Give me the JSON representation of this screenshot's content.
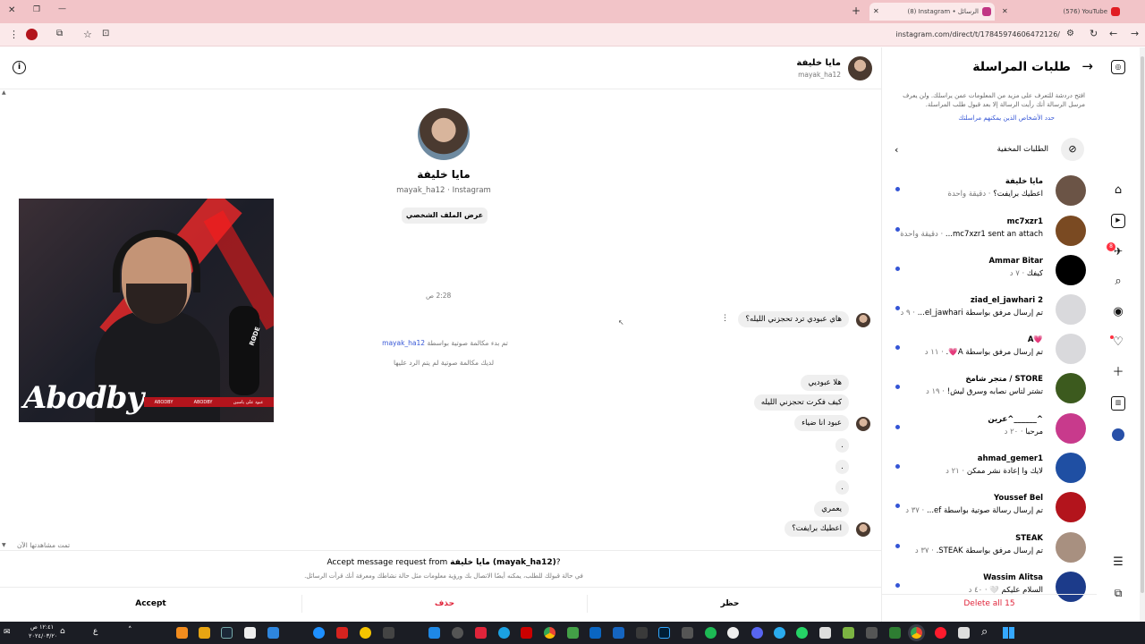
{
  "tabs": [
    {
      "label": "(576) YouTube",
      "favicon_color": "#e11d23"
    },
    {
      "label": "(8) Instagram • الرسائل",
      "favicon_color": "#c13584"
    }
  ],
  "window": {
    "min": "—",
    "restore": "❐",
    "close": "✕",
    "new_tab": "+"
  },
  "address_bar": {
    "url": "instagram.com/direct/t/17845974606472126/"
  },
  "chat_header": {
    "name": "مايا خليفة",
    "username": "mayak_ha12"
  },
  "profile": {
    "name": "مايا خليفة",
    "subtitle": "mayak_ha12 · Instagram",
    "view_profile_button": "عرض الملف الشخصي"
  },
  "video_overlay": {
    "brand_text": "Abodby",
    "mic_brand": "RØDE",
    "ticker": [
      "ABODBY",
      "ABODBY",
      "عبود على ياسين"
    ]
  },
  "messages": {
    "timestamp": "2:28 ص",
    "m1": "هاي عبودي ترد تحجزني الليله؟",
    "call_started_prefix": "تم بدء مكالمة صوتية بواسطة",
    "call_started_user": "mayak_ha12",
    "missed_call": "لديك مكالمة صوتية لم يتم الرد عليها",
    "m2": "هلا عبوديي",
    "m3": "كيف فكرت تحجزني الليله",
    "m4": "عبود انا ضياء",
    "m5": ".",
    "m6": ".",
    "m7": ".",
    "m8": "يعمري",
    "m9": "اعطيك برايفت؟",
    "seen": "تمت مشاهدتها الآن"
  },
  "request_bar": {
    "title_prefix": "Accept message request from",
    "title_name": "مايا خليفة (mayak_ha12)",
    "title_suffix": "?",
    "description": "في حالة قبولك للطلب، يمكنه أيضًا الاتصال بك ورؤية معلومات مثل حالة نشاطك ومعرفة أنك قرأت الرسائل.",
    "accept": "Accept",
    "delete": "حذف",
    "block": "حظر"
  },
  "sidebar": {
    "title": "طلبات المراسلة",
    "info": "افتح دردشة للتعرف على مزيد من المعلومات عمن يراسلك. ولن يعرف مرسل الرسالة أنك رأيت الرسالة إلا بعد قبول طلب المراسلة.",
    "link": "حدد الأشخاص الذين يمكنهم مراسلتك",
    "hidden_requests": "الطلبات المخفية",
    "delete_all": "Delete all 15",
    "requests": [
      {
        "name": "مايا خليفة",
        "preview": "اعطيك برايفت؟",
        "time": "· دقيقة واحدة",
        "avatar_color": "#6b5446"
      },
      {
        "name": "mc7xzr1",
        "preview": "mc7xzr1 sent an attach...",
        "time": "· دقيقة واحدة",
        "avatar_color": "#7a4a22"
      },
      {
        "name": "Ammar Bitar",
        "preview": "كيفك",
        "time": "· ٧ د",
        "avatar_color": "#000000"
      },
      {
        "name": "ziad_el_jawhari 2",
        "preview": "تم إرسال مرفق بواسطة el_jawhari...",
        "time": "· ٩ د",
        "avatar_color": "#d9d9dc"
      },
      {
        "name": "A💗",
        "preview": "تم إرسال مرفق بواسطة A💗.",
        "time": "· ١١ د",
        "avatar_color": "#d9d9dc"
      },
      {
        "name": "متجر شامخ / STORE",
        "preview": "تشتر لتاس نصابه وسرق ليش!",
        "time": "· ١٩ د",
        "avatar_color": "#3c5a1e"
      },
      {
        "name": "عرين^______^",
        "preview": "مرحبا",
        "time": "· ٢٠ د",
        "avatar_color": "#c83a8c"
      },
      {
        "name": "ahmad_gemer1",
        "preview": "لايك وا إعادة نشر ممكن",
        "time": "· ٢١ د",
        "avatar_color": "#1f4fa3"
      },
      {
        "name": "Youssef Bel",
        "preview": "تم إرسال رسالة صوتية بواسطة ef...",
        "time": "· ٣٧ د",
        "avatar_color": "#b3141c"
      },
      {
        "name": "STEAK",
        "preview": "تم إرسال مرفق بواسطة STEAK.",
        "time": "· ٣٧ د",
        "avatar_color": "#a89080"
      },
      {
        "name": "Wassim Alitsa",
        "preview": "السلام عليكم 🤍",
        "time": "· ٤٠ د",
        "avatar_color": "#1c3b8a"
      }
    ]
  },
  "rail": {
    "notif_count": "8"
  },
  "taskbar": {
    "time": "١٢:٤١ ص",
    "date": "٢٠٢٤/٠٣/٢٠",
    "lang": "ع"
  }
}
